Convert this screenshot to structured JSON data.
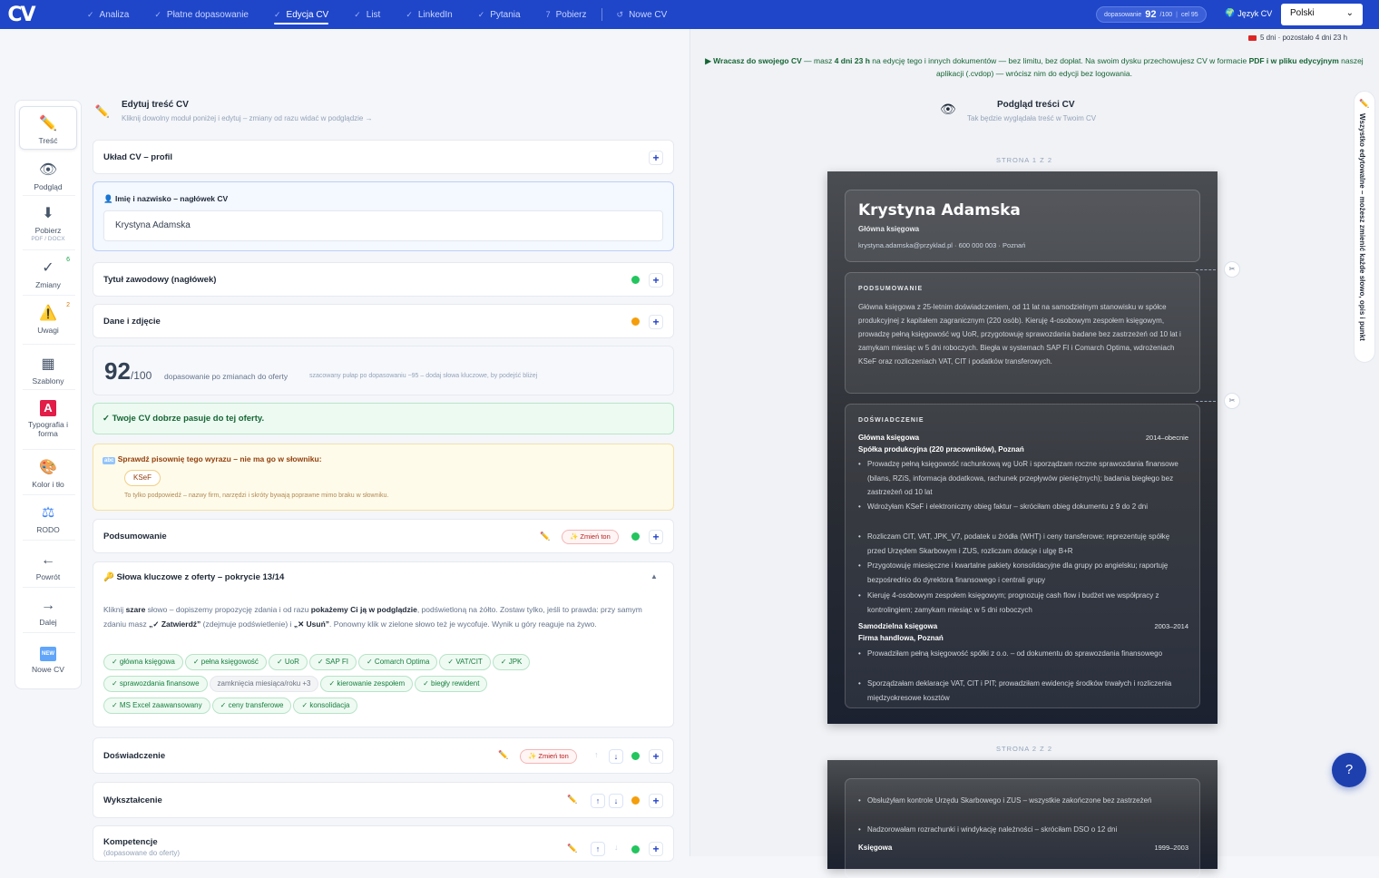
{
  "app": {
    "logo": "CV"
  },
  "nav": {
    "tabs": [
      {
        "mark": "✓",
        "label": "Analiza"
      },
      {
        "mark": "✓",
        "label": "Płatne dopasowanie"
      },
      {
        "mark": "✓",
        "label": "Edycja CV",
        "active": true
      },
      {
        "mark": "✓",
        "label": "List"
      },
      {
        "mark": "✓",
        "label": "LinkedIn"
      },
      {
        "mark": "✓",
        "label": "Pytania"
      },
      {
        "mark": "7",
        "label": "Pobierz"
      },
      {
        "mark": "↺",
        "label": "Nowe CV"
      }
    ]
  },
  "score": {
    "label": "dopasowanie",
    "value": "92",
    "max": "/100",
    "extra": "cel 95"
  },
  "language": {
    "label": "Język CV",
    "flag": "🌍",
    "selected": "Polski"
  },
  "deadline": {
    "text": "5 dni · pozostało 4 dni 23 h"
  },
  "banner": {
    "lead": "▶ Wracasz do swojego CV",
    "mid1": " — masz ",
    "days": "4 dni 23 h",
    "mid2": " na edycję tego i innych dokumentów — bez limitu, bez dopłat. Na swoim dysku przechowujesz CV w formacie ",
    "pdf": "PDF i w pliku edycyjnym",
    "tail": " naszej aplikacji (.cvdop) — wrócisz nim do edycji bez logowania."
  },
  "sidebar": {
    "items": [
      {
        "icon": "✏️",
        "label": "Treść",
        "active": true
      },
      {
        "icon": "👁",
        "label": "Podgląd"
      },
      {
        "icon": "⬇",
        "label": "Pobierz",
        "sub": "PDF / DOCX"
      },
      {
        "icon": "✓",
        "label": "Zmiany",
        "badge": "6"
      },
      {
        "icon": "⚠️",
        "label": "Uwagi",
        "badge": "2"
      },
      {
        "icon": "▦",
        "label": "Szablony"
      },
      {
        "icon": "A",
        "label": "Typografia i forma"
      },
      {
        "icon": "🎨",
        "label": "Kolor i tło"
      },
      {
        "icon": "⚖",
        "label": "RODO"
      },
      {
        "icon": "←",
        "label": "Powrót"
      },
      {
        "icon": "→",
        "label": "Dalej"
      },
      {
        "icon": "NEW",
        "label": "Nowe CV"
      }
    ]
  },
  "editor": {
    "title": "Edytuj treść CV",
    "subtitle": "Kliknij dowolny moduł poniżej i edytuj – zmiany od razu widać w podglądzie →",
    "layout": "Układ CV – profil",
    "name_label": "Imię i nazwisko – nagłówek CV",
    "name_value": "Krystyna Adamska",
    "title_section": "Tytuł zawodowy (nagłówek)",
    "data_section": "Dane i zdjęcie",
    "score_big": "92",
    "score_max": "/100",
    "score_desc": "dopasowanie po zmianach do oferty",
    "score_hint": "szacowany pułap po dopasowaniu ~95 – dodaj słowa kluczowe, by podejść bliżej",
    "fit_ok": "✓ Twoje CV dobrze pasuje do tej oferty.",
    "spell_title": "Sprawdź pisownię tego wyrazu – nie ma go w słowniku:",
    "spell_word": "KSeF",
    "spell_note": "To tylko podpowiedź – nazwy firm, narzędzi i skróty bywają poprawne mimo braku w słowniku.",
    "summary": "Podsumowanie",
    "tone": "✨ Zmień ton",
    "kw_title": "Słowa kluczowe z oferty – pokrycie 13/14",
    "kw_p1": "Kliknij ",
    "kw_b1": "szare",
    "kw_p2": " słowo – dopiszemy propozycję zdania i od razu ",
    "kw_b2": "pokażemy Ci ją w podglądzie",
    "kw_p3": ", podświetloną na żółto. Zostaw tylko, jeśli to prawda: przy samym zdaniu masz ",
    "kw_b3": "„✓ Zatwierdź”",
    "kw_p4": " (zdejmuje podświetlenie) i ",
    "kw_b4": "„✕ Usuń”",
    "kw_p5": ". Ponowny klik w zielone słowo też je wycofuje. Wynik u góry reaguje na żywo.",
    "keywords": [
      {
        "t": "✓ główna księgowa",
        "g": false
      },
      {
        "t": "✓ pełna księgowość",
        "g": false
      },
      {
        "t": "✓ UoR",
        "g": false
      },
      {
        "t": "✓ SAP FI",
        "g": false
      },
      {
        "t": "✓ Comarch Optima",
        "g": false
      },
      {
        "t": "✓ VAT/CIT",
        "g": false
      },
      {
        "t": "✓ JPK",
        "g": false
      },
      {
        "t": "✓ sprawozdania finansowe",
        "g": false
      },
      {
        "t": "zamknięcia miesiąca/roku  +3",
        "g": true
      },
      {
        "t": "✓ kierowanie zespołem",
        "g": false
      },
      {
        "t": "✓ biegły rewident",
        "g": false
      },
      {
        "t": "✓ MS Excel zaawansowany",
        "g": false
      },
      {
        "t": "✓ ceny transferowe",
        "g": false
      },
      {
        "t": "✓ konsolidacja",
        "g": false
      }
    ],
    "experience": "Doświadczenie",
    "education": "Wykształcenie",
    "skills": "Kompetencje",
    "skills_sub": "(dopasowane do oferty)"
  },
  "preview": {
    "title": "Podgląd treści CV",
    "subtitle": "Tak będzie wyglądała treść w Twoim CV",
    "page1": "STRONA 1 Z 2",
    "page2": "STRONA 2 Z 2",
    "name": "Krystyna Adamska",
    "role": "Główna księgowa",
    "contact": "krystyna.adamska@przyklad.pl · 600 000 003 · Poznań",
    "summary_h": "PODSUMOWANIE",
    "summary": "Główna księgowa z 25-letnim doświadczeniem, od 11 lat na samodzielnym stanowisku w spółce produkcyjnej z kapitałem zagranicznym (220 osób). Kieruję 4-osobowym zespołem księgowym, prowadzę pełną księgowość wg UoR, przygotowuję sprawozdania badane bez zastrzeżeń od 10 lat i zamykam miesiąc w 5 dni roboczych. Biegła w systemach SAP FI i Comarch Optima, wdrożeniach KSeF oraz rozliczeniach VAT, CIT i podatków transferowych.",
    "exp_h": "DOŚWIADCZENIE",
    "job1": "Główna księgowa",
    "job1_dt": "2014–obecnie",
    "job1_co": "Spółka produkcyjna (220 pracowników), Poznań",
    "job1_b": [
      "Prowadzę pełną księgowość rachunkową wg UoR i sporządzam roczne sprawozdania finansowe (bilans, RZiS, informacja dodatkowa, rachunek przepływów pieniężnych); badania biegłego bez zastrzeżeń od 10 lat",
      "Wdrożyłam KSeF i elektroniczny obieg faktur – skróciłam obieg dokumentu z 9 do 2 dni",
      "Rozliczam CIT, VAT, JPK_V7, podatek u źródła (WHT) i ceny transferowe; reprezentuję spółkę przed Urzędem Skarbowym i ZUS, rozliczam dotacje i ulgę B+R",
      "Przygotowuję miesięczne i kwartalne pakiety konsolidacyjne dla grupy po angielsku; raportuję bezpośrednio do dyrektora finansowego i centrali grupy",
      "Kieruję 4-osobowym zespołem księgowym; prognozuję cash flow i budżet we współpracy z kontrolingiem; zamykam miesiąc w 5 dni roboczych"
    ],
    "job2": "Samodzielna księgowa",
    "job2_dt": "2003–2014",
    "job2_co": "Firma handlowa, Poznań",
    "job2_b": [
      "Prowadziłam pełną księgowość spółki z o.o. – od dokumentu do sprawozdania finansowego",
      "Sporządzałam deklaracje VAT, CIT i PIT; prowadziłam ewidencję środków trwałych i rozliczenia międzyokresowe kosztów"
    ],
    "p2_b": [
      "Obsłużyłam kontrole Urzędu Skarbowego i ZUS – wszystkie zakończone bez zastrzeżeń",
      "Nadzorowałam rozrachunki i windykację należności – skróciłam DSO o 12 dni"
    ],
    "job3": "Księgowa",
    "job3_dt": "1999–2003",
    "side_note": "Wszystko edytowalne – możesz zmienić każde słowo, opis i punkt"
  },
  "help": "?"
}
